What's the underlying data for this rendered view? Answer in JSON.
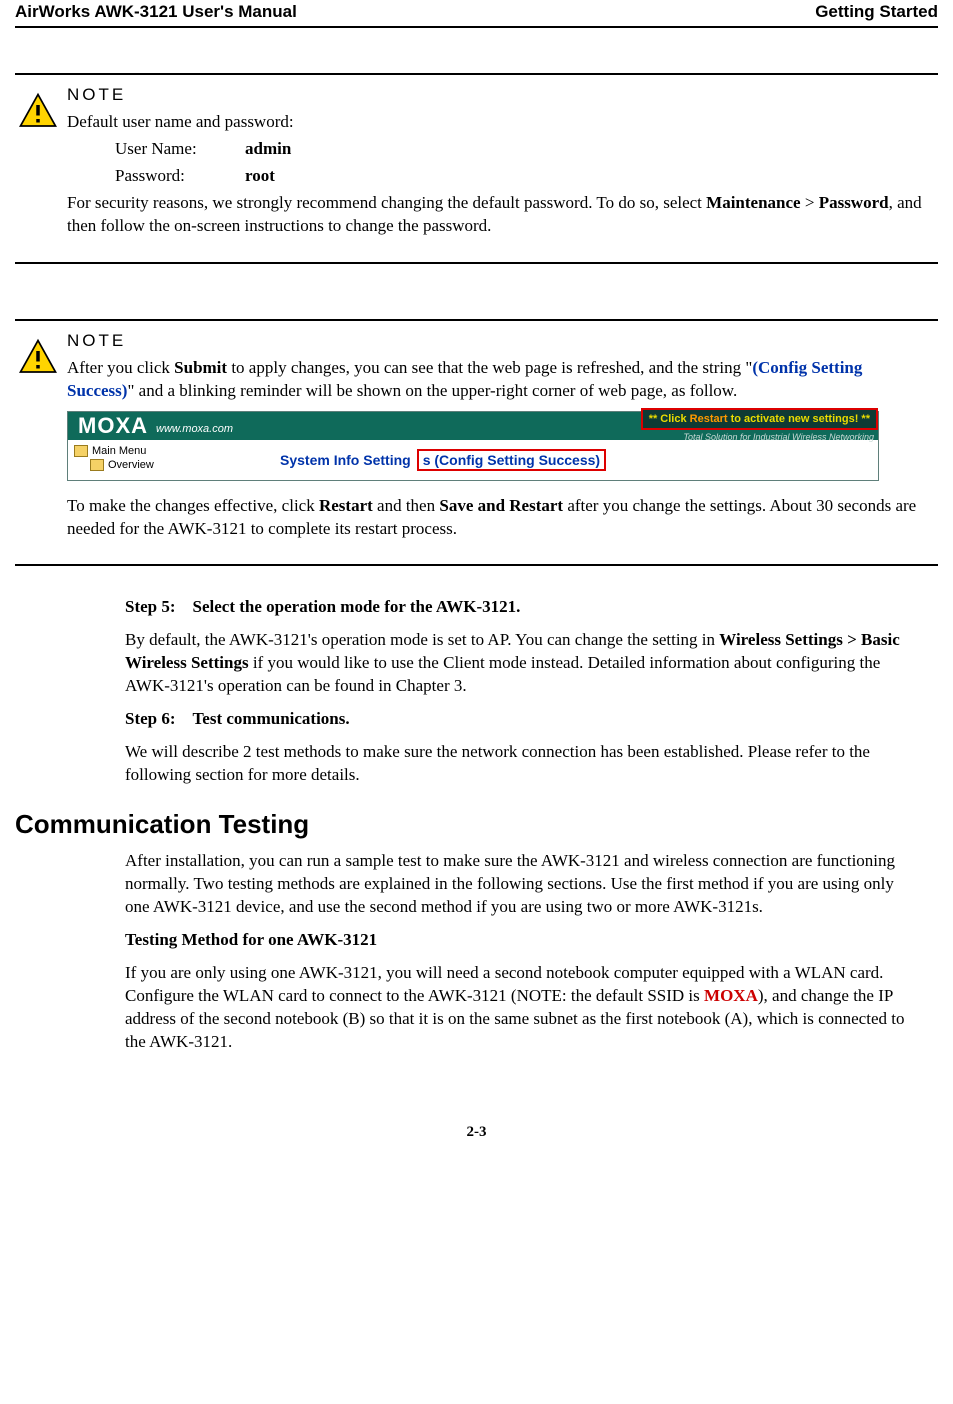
{
  "header": {
    "left": "AirWorks AWK-3121 User's Manual",
    "right": "Getting Started"
  },
  "note1": {
    "label": "NOTE",
    "line1": "Default user name and password:",
    "username_label": "User Name:",
    "username_value": "admin",
    "password_label": "Password:",
    "password_value": "root",
    "para": "For security reasons, we strongly recommend changing the default password. To do so, select ",
    "para_b1": "Maintenance",
    "para_mid": " > ",
    "para_b2": "Password",
    "para_end": ", and then follow the on-screen instructions to change the password."
  },
  "note2": {
    "label": "NOTE",
    "p1_a": "After you click ",
    "p1_b": "Submit",
    "p1_c": " to apply changes, you can see that the web page is refreshed, and the string \"",
    "p1_link": "(Config Setting Success)",
    "p1_d": "\" and a blinking reminder will be shown on the upper-right corner of web page, as follow.",
    "shot": {
      "logo": "MOXA",
      "url": "www.moxa.com",
      "restart_pre": "** Click ",
      "restart_word": "Restart",
      "restart_post": " to activate new settings! **",
      "sub": "Total Solution for Industrial Wireless Networking",
      "menu1": "Main Menu",
      "menu2": "Overview",
      "sys_pre": "System Info Setting",
      "sys_s": "s",
      "sys_cfg": " (Config Setting Success)"
    },
    "p2_a": "To make the changes effective, click ",
    "p2_b": "Restart",
    "p2_c": " and then ",
    "p2_d": "Save and Restart",
    "p2_e": " after you change the settings. About 30 seconds are needed for the AWK-3121 to complete its restart process."
  },
  "steps": {
    "s5_label": "Step 5:",
    "s5_text": "Select the operation mode for the AWK-3121.",
    "s5_p_a": "By default, the AWK-3121's operation mode is set to AP. You can change the setting in ",
    "s5_p_b": "Wireless Settings > Basic Wireless Settings",
    "s5_p_c": " if you would like to use the Client mode instead. Detailed information about configuring the AWK-3121's operation can be found in Chapter 3.",
    "s6_label": "Step 6:",
    "s6_text": "Test communications.",
    "s6_p": "We will describe 2 test methods to make sure the network connection has been established. Please refer to the following section for more details."
  },
  "comm": {
    "heading": "Communication Testing",
    "p1": "After installation, you can run a sample test to make sure the AWK-3121 and wireless connection are functioning normally. Two testing methods are explained in the following sections. Use the first method if you are using only one AWK-3121 device, and use the second method if you are using two or more AWK-3121s.",
    "sub1": "Testing Method for one AWK-3121",
    "p2_a": "If you are only using one AWK-3121, you will need a second notebook computer equipped with a WLAN card. Configure the WLAN card to connect to the AWK-3121 (NOTE: the default SSID is ",
    "p2_b": "MOXA",
    "p2_c": "), and change the IP address of the second notebook (B) so that it is on the same subnet as the first notebook (A), which is connected to the AWK-3121."
  },
  "page_number": "2-3"
}
